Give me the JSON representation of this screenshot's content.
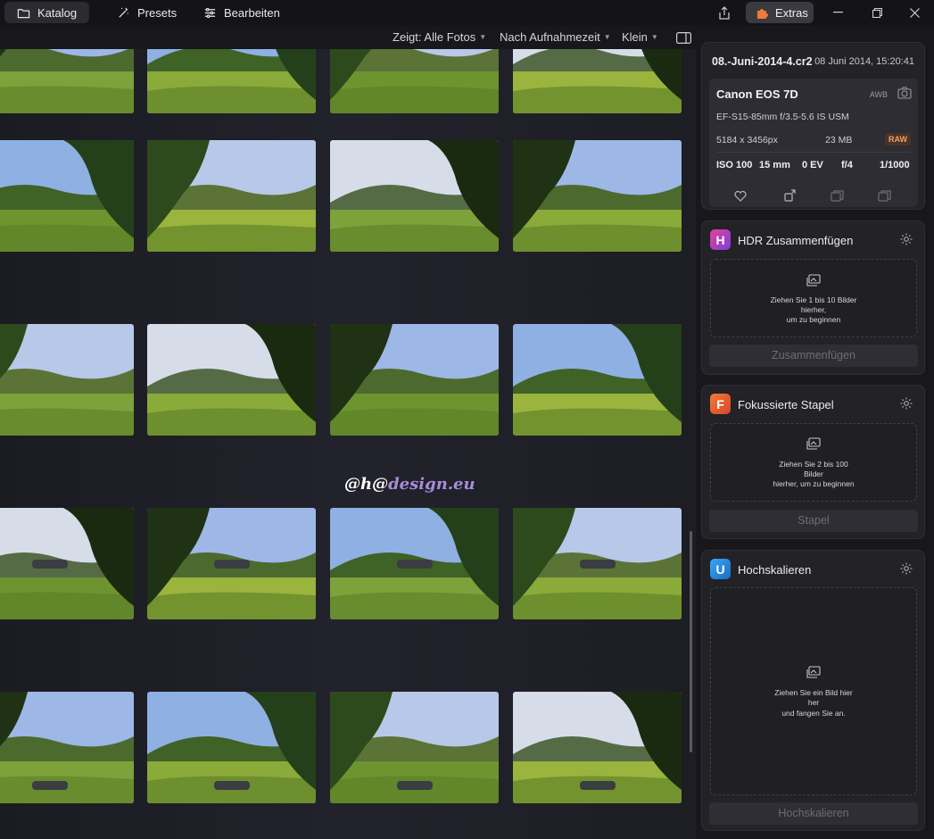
{
  "topbar": {
    "tabs": [
      {
        "label": "Katalog"
      },
      {
        "label": "Presets"
      },
      {
        "label": "Bearbeiten"
      }
    ],
    "extras_label": "Extras"
  },
  "filters": {
    "show": "Zeigt: Alle Fotos",
    "sort": "Nach Aufnahmezeit",
    "size": "Klein"
  },
  "watermark": {
    "part1": "@",
    "part2": "h",
    "part3": "@",
    "part4": "design.eu"
  },
  "info": {
    "filename": "08.-Juni-2014-4.cr2",
    "date": "08 Juni 2014, 15:20:41",
    "camera": "Canon EOS 7D",
    "awb": "AWB",
    "lens": "EF-S15-85mm f/3.5-5.6 IS USM",
    "resolution": "5184 x 3456px",
    "filesize": "23 MB",
    "format": "RAW",
    "iso": "ISO 100",
    "focal": "15 mm",
    "ev": "0 EV",
    "aperture": "f/4",
    "shutter": "1/1000"
  },
  "tools": [
    {
      "badge": "H",
      "title": "HDR Zusammenfügen",
      "line1": "Ziehen Sie 1 bis 10 Bilder",
      "line2": "hierher,",
      "line3": "um zu beginnen",
      "button": "Zusammenfügen",
      "color": "#c43bd0"
    },
    {
      "badge": "F",
      "title": "Fokussierte Stapel",
      "line1": "Ziehen Sie 2 bis 100",
      "line2": "Bilder",
      "line3": "hierher, um zu beginnen",
      "button": "Stapel",
      "color": "#ef6a2c"
    },
    {
      "badge": "U",
      "title": "Hochskalieren",
      "line1": "Ziehen Sie ein Bild hier",
      "line2": "her",
      "line3": "und fangen Sie an.",
      "button": "Hochskalieren",
      "color": "#2a86d8"
    }
  ]
}
